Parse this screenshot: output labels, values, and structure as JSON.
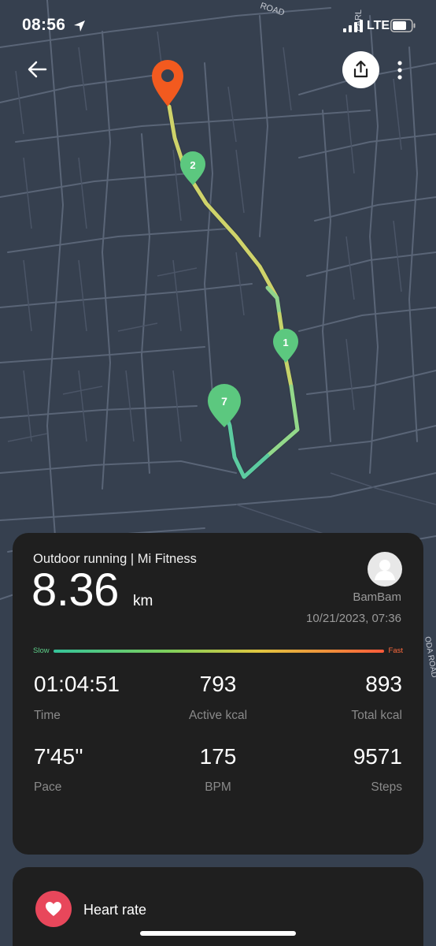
{
  "status_bar": {
    "time": "08:56",
    "network": "LTE"
  },
  "map": {
    "street_labels": [
      "ROAD",
      "PARL",
      "ODA ROAD"
    ],
    "markers": [
      {
        "label": "2",
        "color": "#5cc87f"
      },
      {
        "label": "1",
        "color": "#5cc87f"
      },
      {
        "label": "7",
        "color": "#5cc87f"
      }
    ],
    "start_marker_color": "#f25a1f"
  },
  "workout": {
    "title": "Outdoor running | Mi Fitness",
    "distance": "8.36",
    "distance_unit": "km",
    "user_name": "BamBam",
    "datetime": "10/21/2023, 07:36",
    "scale": {
      "slow": "Slow",
      "fast": "Fast"
    },
    "stats": [
      {
        "value": "01:04:51",
        "label": "Time"
      },
      {
        "value": "793",
        "label": "Active kcal"
      },
      {
        "value": "893",
        "label": "Total kcal"
      },
      {
        "value": "7'45''",
        "label": "Pace"
      },
      {
        "value": "175",
        "label": "BPM"
      },
      {
        "value": "9571",
        "label": "Steps"
      }
    ]
  },
  "heart_rate": {
    "title": "Heart rate"
  },
  "icons": [
    "location-arrow-icon",
    "signal-icon",
    "battery-icon",
    "back-arrow-icon",
    "share-icon",
    "more-icon",
    "user-icon",
    "heart-icon"
  ]
}
